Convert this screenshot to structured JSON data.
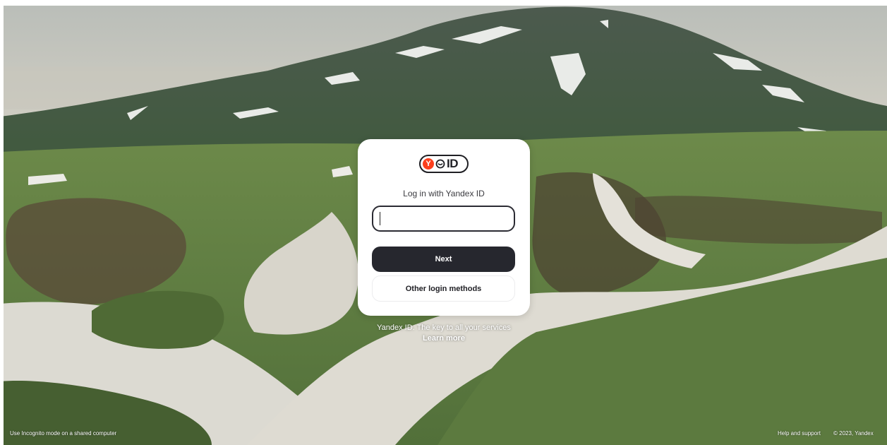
{
  "background": {
    "description_icon": "mountain-landscape-photo"
  },
  "card": {
    "logo": {
      "y_letter": "Y",
      "id_text": "ID"
    },
    "title": "Log in with Yandex ID",
    "login_input": {
      "value": "",
      "placeholder": ""
    },
    "next_label": "Next",
    "other_methods_label": "Other login methods"
  },
  "promo": {
    "tagline": "Yandex ID. The key to all your services",
    "learn_more": "Learn more"
  },
  "footer": {
    "incognito_hint": "Use Incognito mode on a shared computer",
    "help": "Help and support",
    "copyright": "© 2023, Yandex"
  },
  "colors": {
    "brand_red": "#fc3f1d",
    "primary_button": "#26272e",
    "card_background": "#ffffff"
  }
}
